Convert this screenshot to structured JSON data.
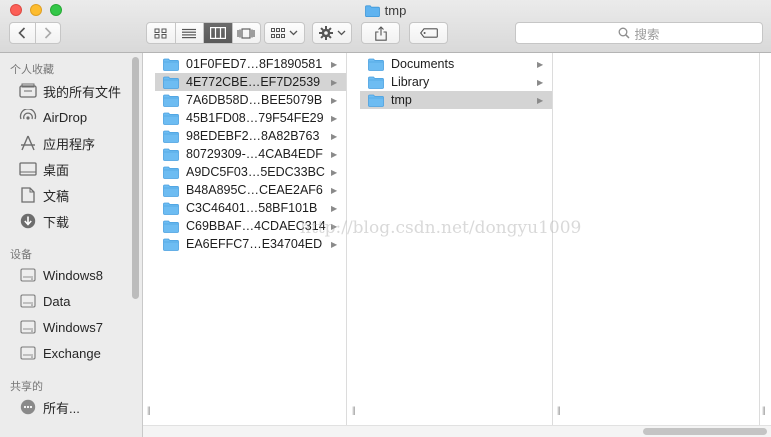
{
  "window": {
    "title": "tmp"
  },
  "toolbar": {
    "search_placeholder": "搜索",
    "view_modes": [
      "icon-view",
      "list-view",
      "column-view",
      "cover-flow-view"
    ],
    "active_view": "column-view"
  },
  "sidebar": {
    "favorites_header": "个人收藏",
    "favorites": [
      {
        "label": "我的所有文件",
        "icon": "all-files-icon"
      },
      {
        "label": "AirDrop",
        "icon": "airdrop-icon"
      },
      {
        "label": "应用程序",
        "icon": "applications-icon"
      },
      {
        "label": "桌面",
        "icon": "desktop-icon"
      },
      {
        "label": "文稿",
        "icon": "documents-icon"
      },
      {
        "label": "下载",
        "icon": "downloads-icon"
      }
    ],
    "devices_header": "设备",
    "devices": [
      {
        "label": "Windows8",
        "icon": "disk-icon"
      },
      {
        "label": "Data",
        "icon": "disk-icon"
      },
      {
        "label": "Windows7",
        "icon": "disk-icon"
      },
      {
        "label": "Exchange",
        "icon": "disk-icon"
      }
    ],
    "shared_header": "共享的",
    "shared": [
      {
        "label": "所有...",
        "icon": "network-icon"
      }
    ]
  },
  "columns": {
    "col1": [
      "01F0FED7…8F1890581",
      "4E772CBE…EF7D2539",
      "7A6DB58D…BEE5079B",
      "45B1FD08…79F54FE29",
      "98EDEBF2…8A82B763",
      "80729309-…4CAB4EDF",
      "A9DC5F03…5EDC33BC",
      "B48A895C…CEAE2AF6",
      "C3C46401…58BF101B",
      "C69BBAF…4CDAEC314",
      "EA6EFFC7…E34704ED"
    ],
    "col1_selected": 1,
    "col2": [
      "Documents",
      "Library",
      "tmp"
    ],
    "col2_selected": 2
  },
  "watermark": "http://blog.csdn.net/dongyu1009",
  "colors": {
    "folder_blue": "#5fb3f0",
    "selection_gray": "#d4d4d4"
  }
}
